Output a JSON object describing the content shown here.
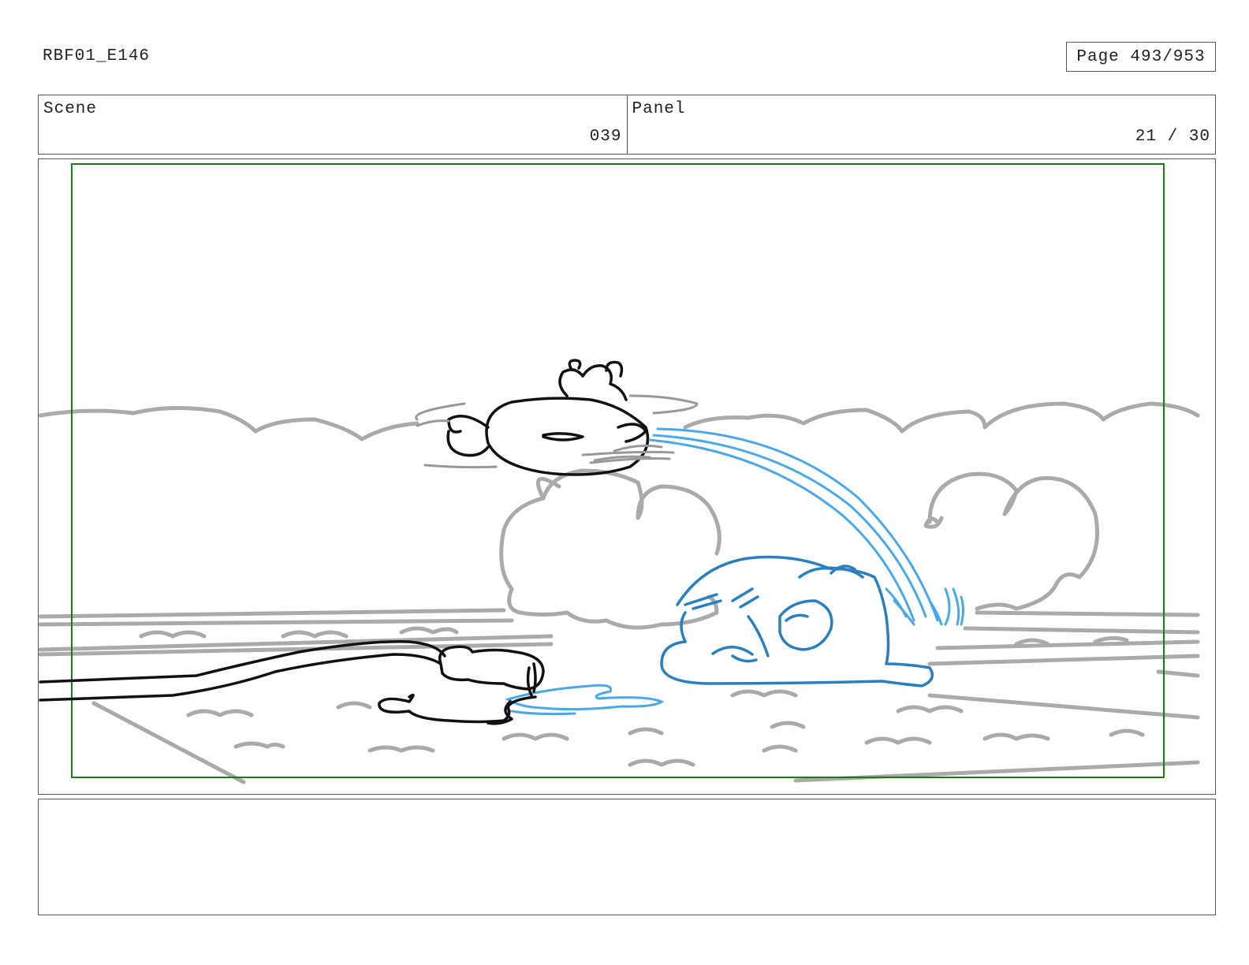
{
  "header": {
    "doc_id": "RBF01_E146",
    "page_label": "Page 493/953"
  },
  "info": {
    "scene_label": "Scene",
    "scene_value": "039",
    "panel_label": "Panel",
    "panel_value": "21 / 30"
  },
  "panel_drawing": {
    "safe_frame_color": "#1a7a1a",
    "line_colors": {
      "background": "#aaaaaa",
      "character_black": "#111111",
      "character_blue": "#2a7fc0",
      "water": "#4aa8e8"
    }
  },
  "notes": {
    "text": ""
  }
}
